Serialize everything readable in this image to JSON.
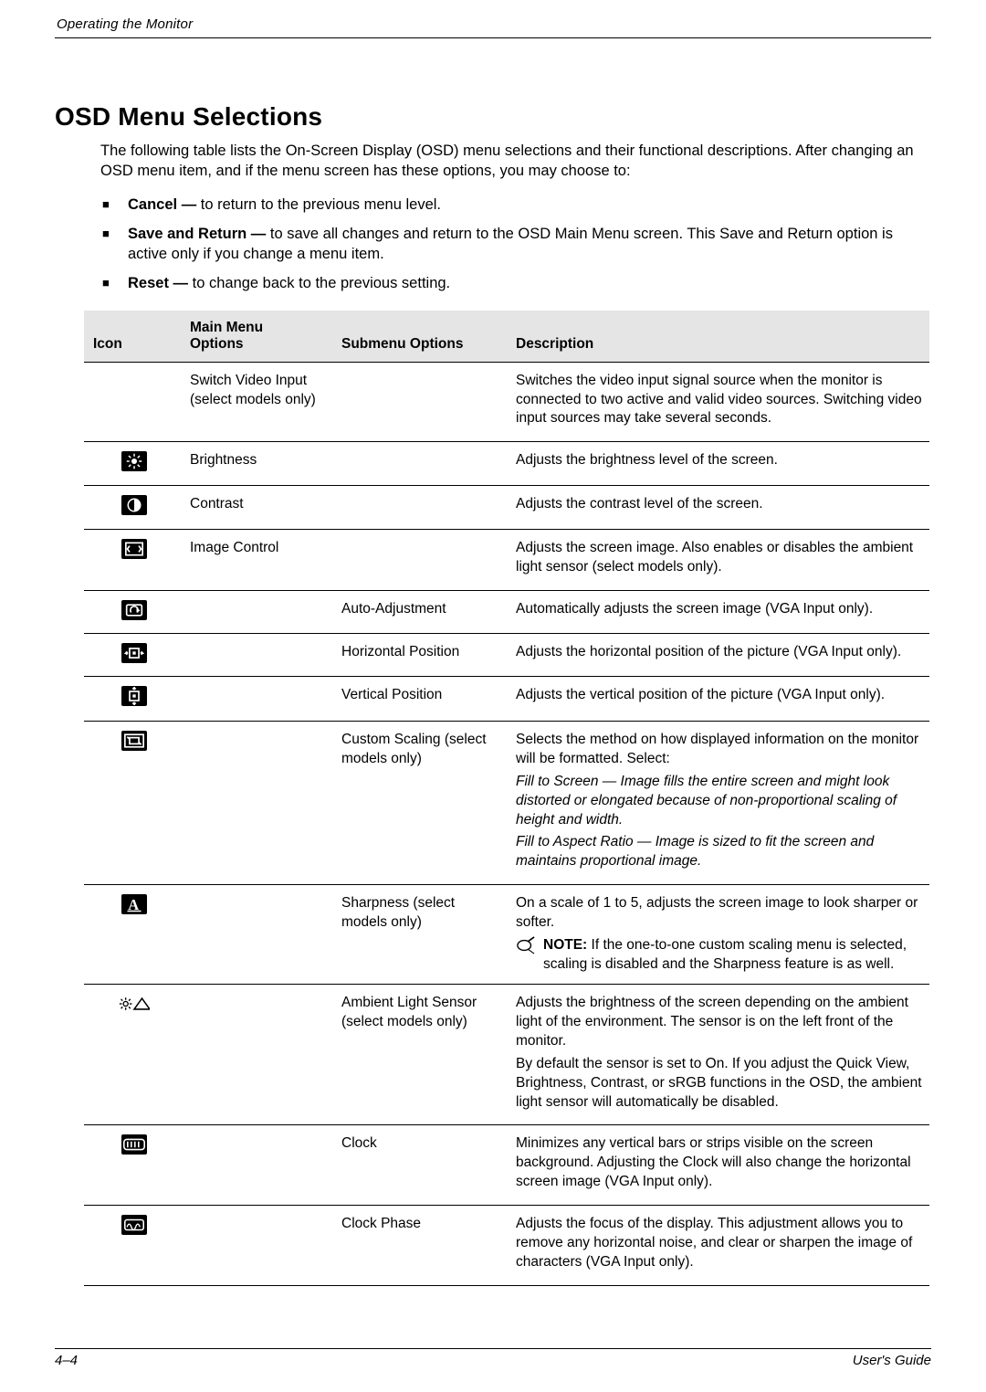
{
  "header": {
    "running": "Operating the Monitor"
  },
  "title": "OSD Menu Selections",
  "intro": "The following table lists the On-Screen Display (OSD) menu selections and their functional descriptions. After changing an OSD menu item, and if the menu screen has these options, you may choose to:",
  "bullets": [
    {
      "label": "Cancel —",
      "text": " to return to the previous menu level."
    },
    {
      "label": "Save and Return —",
      "text": " to save all changes and return to the OSD Main Menu screen. This Save and Return option is active only if you change a menu item."
    },
    {
      "label": "Reset —",
      "text": " to change back to the previous setting."
    }
  ],
  "table": {
    "headers": {
      "icon": "Icon",
      "main_l1": "Main Menu",
      "main_l2": "Options",
      "sub": "Submenu Options",
      "desc": "Description"
    },
    "rows": [
      {
        "icon": "",
        "main": "Switch Video Input (select models only)",
        "sub": "",
        "desc_parts": [
          {
            "t": "p",
            "text": "Switches the video input signal source when the monitor is connected to two active and valid video sources. Switching video input sources may take several seconds."
          }
        ]
      },
      {
        "icon": "brightness",
        "main": "Brightness",
        "sub": "",
        "desc_parts": [
          {
            "t": "p",
            "text": "Adjusts the brightness level of the screen."
          }
        ]
      },
      {
        "icon": "contrast",
        "main": "Contrast",
        "sub": "",
        "desc_parts": [
          {
            "t": "p",
            "text": "Adjusts the contrast level of the screen."
          }
        ]
      },
      {
        "icon": "image-control",
        "main": "Image Control",
        "sub": "",
        "desc_parts": [
          {
            "t": "p",
            "text": "Adjusts the screen image. Also enables or disables the ambient light sensor (select models only)."
          }
        ]
      },
      {
        "icon": "auto-adjust",
        "main": "",
        "sub": "Auto-Adjustment",
        "desc_parts": [
          {
            "t": "p",
            "text": "Automatically adjusts the screen image (VGA Input only)."
          }
        ]
      },
      {
        "icon": "h-position",
        "main": "",
        "sub": "Horizontal Position",
        "desc_parts": [
          {
            "t": "p",
            "text": "Adjusts the horizontal position of the picture (VGA Input only)."
          }
        ]
      },
      {
        "icon": "v-position",
        "main": "",
        "sub": "Vertical Position",
        "desc_parts": [
          {
            "t": "p",
            "text": "Adjusts the vertical position of the picture (VGA Input only)."
          }
        ]
      },
      {
        "icon": "custom-scaling",
        "main": "",
        "sub": "Custom Scaling (select models only)",
        "desc_parts": [
          {
            "t": "p",
            "text": "Selects the method on how displayed information on the monitor will be formatted. Select:"
          },
          {
            "t": "pi",
            "text": "Fill to Screen — Image fills the entire screen and might look distorted or elongated because of non-proportional scaling of height and width."
          },
          {
            "t": "pi",
            "text": "Fill to Aspect Ratio — Image is sized to fit the screen and maintains proportional image."
          }
        ]
      },
      {
        "icon": "sharpness",
        "main": "",
        "sub": "Sharpness (select models only)",
        "desc_parts": [
          {
            "t": "p",
            "text": "On a scale of 1 to 5, adjusts the screen image to look sharper or softer."
          },
          {
            "t": "note",
            "bold": "NOTE:",
            "text": " If the one-to-one custom scaling menu is selected, scaling is disabled and the Sharpness feature is as well."
          }
        ]
      },
      {
        "icon": "ambient-light",
        "main": "",
        "sub": "Ambient Light Sensor (select models only)",
        "desc_parts": [
          {
            "t": "p",
            "text": "Adjusts the brightness of the screen depending on the ambient light of the environment. The sensor is on the left front of the monitor."
          },
          {
            "t": "p",
            "text": "By default the sensor is set to On. If you adjust the Quick View, Brightness, Contrast, or sRGB functions in the OSD, the ambient light sensor will automatically be disabled."
          }
        ]
      },
      {
        "icon": "clock",
        "main": "",
        "sub": "Clock",
        "desc_parts": [
          {
            "t": "p",
            "text": "Minimizes any vertical bars or strips visible on the screen background. Adjusting the Clock will also change the horizontal screen image (VGA Input only)."
          }
        ]
      },
      {
        "icon": "clock-phase",
        "main": "",
        "sub": "Clock Phase",
        "desc_parts": [
          {
            "t": "p",
            "text": "Adjusts the focus of the display. This adjustment allows you to remove any horizontal noise, and clear or sharpen the image of characters (VGA Input only)."
          }
        ]
      }
    ]
  },
  "footer": {
    "page": "4–4",
    "guide": "User's Guide"
  }
}
